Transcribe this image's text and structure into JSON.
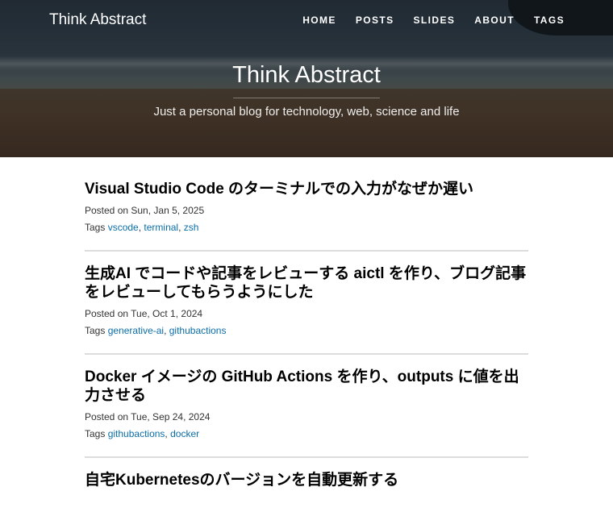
{
  "site": {
    "brand": "Think Abstract",
    "nav": [
      "HOME",
      "POSTS",
      "SLIDES",
      "ABOUT",
      "TAGS"
    ],
    "hero_title": "Think Abstract",
    "hero_subtitle": "Just a personal blog for technology, web, science and life"
  },
  "posts": [
    {
      "title": "Visual Studio Code のターミナルでの入力がなぜか遅い",
      "posted": "Posted on Sun, Jan 5, 2025",
      "tags_label": "Tags",
      "tags": [
        "vscode",
        "terminal",
        "zsh"
      ]
    },
    {
      "title": "生成AI でコードや記事をレビューする aictl を作り、ブログ記事をレビューしてもらうようにした",
      "posted": "Posted on Tue, Oct 1, 2024",
      "tags_label": "Tags",
      "tags": [
        "generative-ai",
        "githubactions"
      ]
    },
    {
      "title": "Docker イメージの GitHub Actions を作り、outputs に値を出力させる",
      "posted": "Posted on Tue, Sep 24, 2024",
      "tags_label": "Tags",
      "tags": [
        "githubactions",
        "docker"
      ]
    },
    {
      "title": "自宅Kubernetesのバージョンを自動更新する",
      "posted": "",
      "tags_label": "",
      "tags": []
    }
  ]
}
